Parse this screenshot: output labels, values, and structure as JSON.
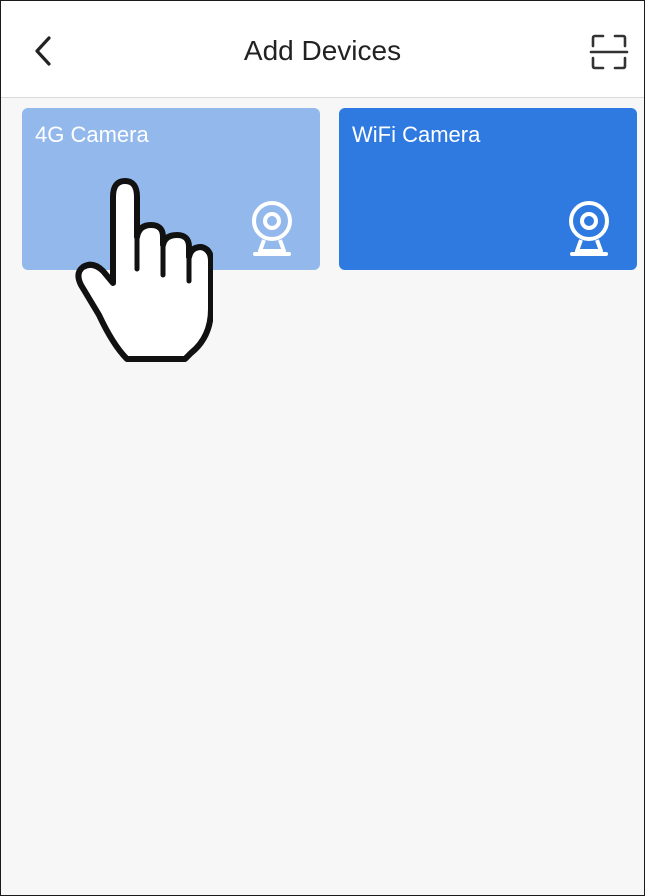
{
  "header": {
    "title": "Add Devices"
  },
  "icons": {
    "back": "chevron-left-icon",
    "scan": "scan-icon",
    "camera": "webcam-icon",
    "pointer": "hand-pointer-icon"
  },
  "tiles": [
    {
      "label": "4G Camera",
      "color": "#93b9ec",
      "state": "pressed"
    },
    {
      "label": "WiFi Camera",
      "color": "#2f7ae0"
    }
  ],
  "colors": {
    "header_bg": "#ffffff",
    "page_bg": "#f7f7f7"
  }
}
